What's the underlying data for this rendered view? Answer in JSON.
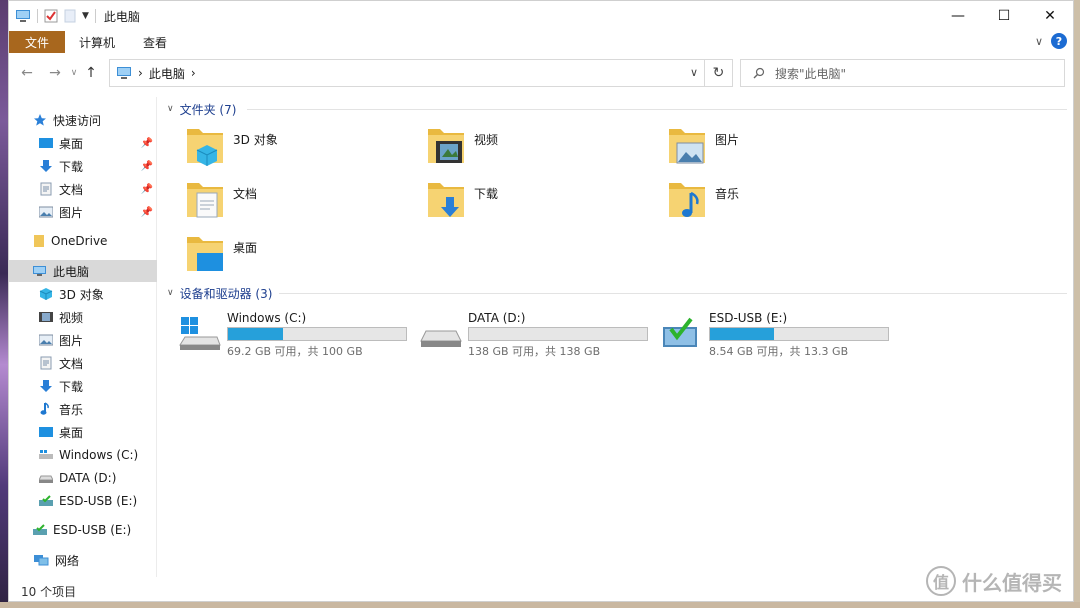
{
  "window": {
    "title": "此电脑"
  },
  "titlebar": {
    "minimize": "—",
    "maximize": "☐",
    "close": "✕"
  },
  "ribbon": {
    "tabs": [
      "文件",
      "计算机",
      "查看"
    ],
    "expand_icon": "∨",
    "help": "?"
  },
  "address": {
    "location": "此电脑",
    "chevron": "›",
    "dropdown": "∨",
    "refresh": "↻"
  },
  "search": {
    "placeholder": "搜索\"此电脑\""
  },
  "nav": {
    "quick_access": "快速访问",
    "quick_items": [
      {
        "label": "桌面",
        "icon": "desktop-icon"
      },
      {
        "label": "下载",
        "icon": "download-icon"
      },
      {
        "label": "文档",
        "icon": "document-icon"
      },
      {
        "label": "图片",
        "icon": "picture-icon"
      }
    ],
    "onedrive": "OneDrive",
    "this_pc": "此电脑",
    "pc_items": [
      {
        "label": "3D 对象"
      },
      {
        "label": "视频"
      },
      {
        "label": "图片"
      },
      {
        "label": "文档"
      },
      {
        "label": "下载"
      },
      {
        "label": "音乐"
      },
      {
        "label": "桌面"
      },
      {
        "label": "Windows (C:)"
      },
      {
        "label": "DATA (D:)"
      },
      {
        "label": "ESD-USB (E:)"
      }
    ],
    "esd_usb": "ESD-USB (E:)",
    "network": "网络"
  },
  "folders_group": {
    "header": "文件夹 (7)",
    "items": [
      {
        "label": "3D 对象",
        "icon": "3d-objects-folder-icon"
      },
      {
        "label": "视频",
        "icon": "videos-folder-icon"
      },
      {
        "label": "图片",
        "icon": "pictures-folder-icon"
      },
      {
        "label": "文档",
        "icon": "documents-folder-icon"
      },
      {
        "label": "下载",
        "icon": "downloads-folder-icon"
      },
      {
        "label": "音乐",
        "icon": "music-folder-icon"
      },
      {
        "label": "桌面",
        "icon": "desktop-folder-icon"
      }
    ]
  },
  "drives_group": {
    "header": "设备和驱动器 (3)",
    "items": [
      {
        "name": "Windows (C:)",
        "free": "69.2 GB 可用，共 100 GB",
        "used_fraction": 0.31
      },
      {
        "name": "DATA (D:)",
        "free": "138 GB 可用，共 138 GB",
        "used_fraction": 0.0
      },
      {
        "name": "ESD-USB (E:)",
        "free": "8.54 GB 可用，共 13.3 GB",
        "used_fraction": 0.36
      }
    ]
  },
  "status": {
    "count": "10 个项目"
  },
  "watermark": {
    "text": "什么值得买",
    "glyph": "值"
  },
  "colors": {
    "accent": "#26a0da",
    "file_tab": "#a8671e",
    "group_header": "#1e3f8f",
    "folder": "#f0c659"
  }
}
